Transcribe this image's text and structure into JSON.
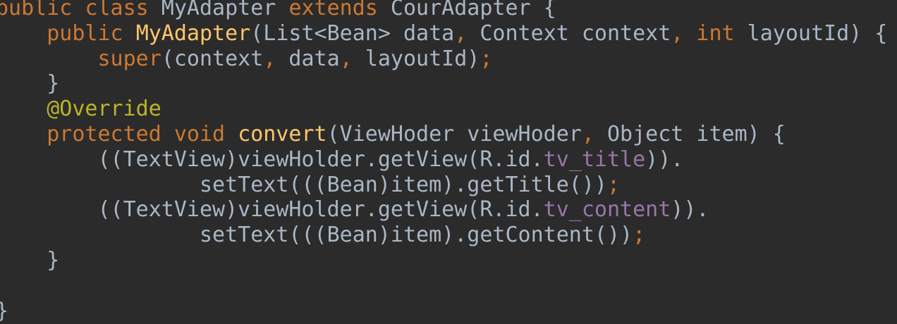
{
  "editor": {
    "lines": [
      [
        {
          "t": "public",
          "c": "kw"
        },
        {
          "t": " ",
          "c": "pl"
        },
        {
          "t": "class",
          "c": "kw"
        },
        {
          "t": " MyAdapter ",
          "c": "pl"
        },
        {
          "t": "extends",
          "c": "kw"
        },
        {
          "t": " CourAdapter {",
          "c": "pl"
        }
      ],
      [
        {
          "t": "    ",
          "c": "pl"
        },
        {
          "t": "public",
          "c": "kw"
        },
        {
          "t": " ",
          "c": "pl"
        },
        {
          "t": "MyAdapter",
          "c": "fn"
        },
        {
          "t": "(List<Bean> data",
          "c": "pl"
        },
        {
          "t": ",",
          "c": "kw"
        },
        {
          "t": " Context context",
          "c": "pl"
        },
        {
          "t": ",",
          "c": "kw"
        },
        {
          "t": " ",
          "c": "pl"
        },
        {
          "t": "int",
          "c": "kw"
        },
        {
          "t": " layoutId) {",
          "c": "pl"
        }
      ],
      [
        {
          "t": "        ",
          "c": "pl"
        },
        {
          "t": "super",
          "c": "kw"
        },
        {
          "t": "(context",
          "c": "pl"
        },
        {
          "t": ",",
          "c": "kw"
        },
        {
          "t": " data",
          "c": "pl"
        },
        {
          "t": ",",
          "c": "kw"
        },
        {
          "t": " layoutId)",
          "c": "pl"
        },
        {
          "t": ";",
          "c": "semi"
        }
      ],
      [
        {
          "t": "    }",
          "c": "pl"
        }
      ],
      [
        {
          "t": "    ",
          "c": "pl"
        },
        {
          "t": "@Override",
          "c": "ann"
        }
      ],
      [
        {
          "t": "    ",
          "c": "pl"
        },
        {
          "t": "protected",
          "c": "kw"
        },
        {
          "t": " ",
          "c": "pl"
        },
        {
          "t": "void",
          "c": "kw"
        },
        {
          "t": " ",
          "c": "pl"
        },
        {
          "t": "convert",
          "c": "fn"
        },
        {
          "t": "(ViewHoder viewHoder",
          "c": "pl"
        },
        {
          "t": ",",
          "c": "kw"
        },
        {
          "t": " Object item) {",
          "c": "pl"
        }
      ],
      [
        {
          "t": "        ((TextView)viewHolder.getView(R.id.",
          "c": "pl"
        },
        {
          "t": "tv_title",
          "c": "fld"
        },
        {
          "t": ")).",
          "c": "pl"
        }
      ],
      [
        {
          "t": "                setText(((Bean)item).getTitle())",
          "c": "pl"
        },
        {
          "t": ";",
          "c": "semi"
        }
      ],
      [
        {
          "t": "        ((TextView)viewHolder.getView(R.id.",
          "c": "pl"
        },
        {
          "t": "tv_content",
          "c": "fld"
        },
        {
          "t": ")).",
          "c": "pl"
        }
      ],
      [
        {
          "t": "                setText(((Bean)item).getContent())",
          "c": "pl"
        },
        {
          "t": ";",
          "c": "semi"
        }
      ],
      [
        {
          "t": "    }",
          "c": "pl"
        }
      ],
      [
        {
          "t": "",
          "c": "pl"
        }
      ],
      [
        {
          "t": "}",
          "c": "pl"
        }
      ]
    ],
    "colors": {
      "background": "#2b2b2b",
      "plain": "#a9b7c6",
      "keyword": "#cc7832",
      "method_declaration": "#ffc66d",
      "annotation": "#bbb529",
      "field": "#9876aa"
    }
  }
}
